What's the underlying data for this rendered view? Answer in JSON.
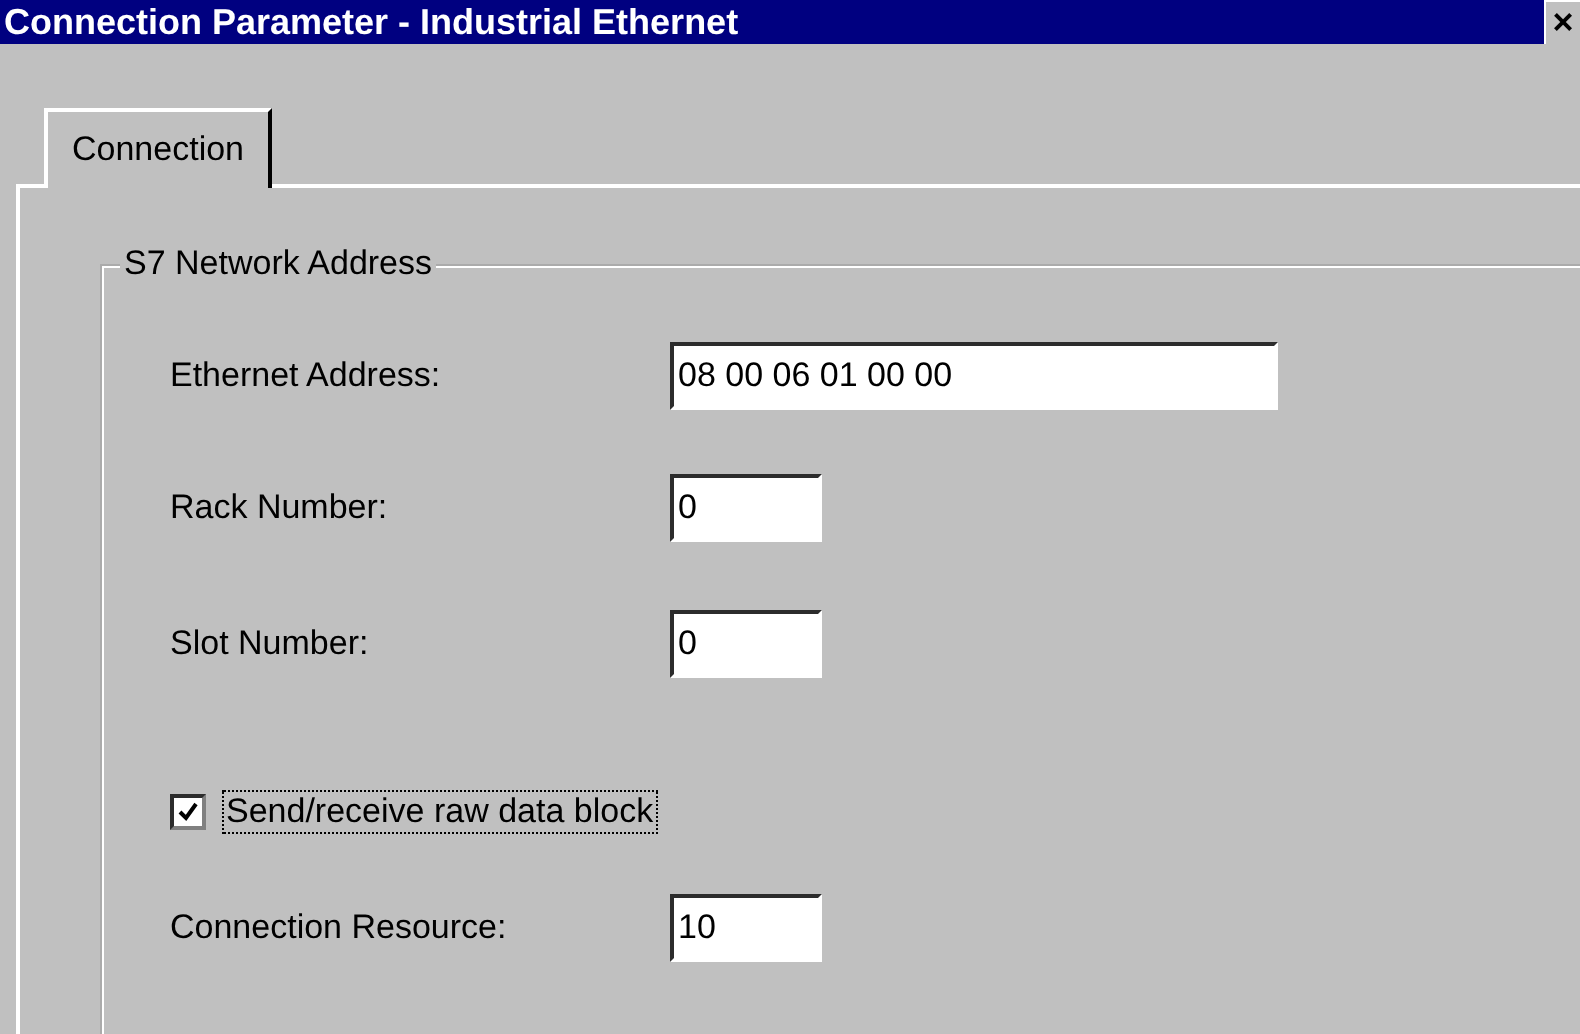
{
  "window": {
    "title": "Connection Parameter - Industrial Ethernet",
    "close": "×"
  },
  "tabs": [
    {
      "label": "Connection",
      "selected": true
    }
  ],
  "group": {
    "title": "S7 Network Address",
    "rows": [
      {
        "kind": "field",
        "label": "Ethernet Address:",
        "value": "08 00 06 01 00 00",
        "wide": true
      },
      {
        "kind": "field",
        "label": "Rack Number:",
        "value": "0",
        "wide": false
      },
      {
        "kind": "field",
        "label": "Slot Number:",
        "value": "0",
        "wide": false
      },
      {
        "kind": "checkbox",
        "label": "Send/receive raw data block",
        "checked": true
      },
      {
        "kind": "field",
        "label": "Connection Resource:",
        "value": "10",
        "wide": false
      }
    ]
  }
}
